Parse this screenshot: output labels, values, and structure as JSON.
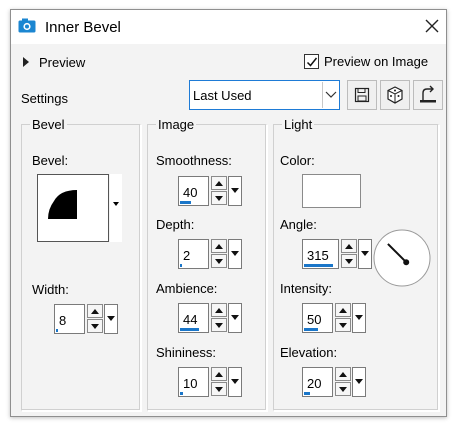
{
  "window": {
    "title": "Inner Bevel"
  },
  "top": {
    "preview_label": "Preview",
    "preview_on_image_label": "Preview on Image",
    "preview_on_image_checked": true,
    "settings_label": "Settings",
    "settings_value": "Last Used"
  },
  "bevel_group": {
    "title": "Bevel",
    "bevel_label": "Bevel:",
    "width_label": "Width:",
    "width": {
      "value": "8",
      "fill": 0.08
    }
  },
  "image_group": {
    "title": "Image",
    "smoothness": {
      "label": "Smoothness:",
      "value": "40",
      "fill": 0.4
    },
    "depth": {
      "label": "Depth:",
      "value": "2",
      "fill": 0.02
    },
    "ambience": {
      "label": "Ambience:",
      "value": "44",
      "fill": 0.72
    },
    "shininess": {
      "label": "Shininess:",
      "value": "10",
      "fill": 0.1
    }
  },
  "light_group": {
    "title": "Light",
    "color_label": "Color:",
    "color": "#ffffff",
    "angle": {
      "label": "Angle:",
      "value": "315",
      "fill": 0.875
    },
    "intensity": {
      "label": "Intensity:",
      "value": "50",
      "fill": 0.5
    },
    "elevation": {
      "label": "Elevation:",
      "value": "20",
      "fill": 0.22
    }
  },
  "colors": {
    "accent": "#1a76c9",
    "focus_border": "#1e7bd6"
  },
  "icons": [
    "photo-icon",
    "close-icon",
    "save-icon",
    "randomize-dice-icon",
    "reset-icon",
    "dropdown-arrow-icon"
  ]
}
